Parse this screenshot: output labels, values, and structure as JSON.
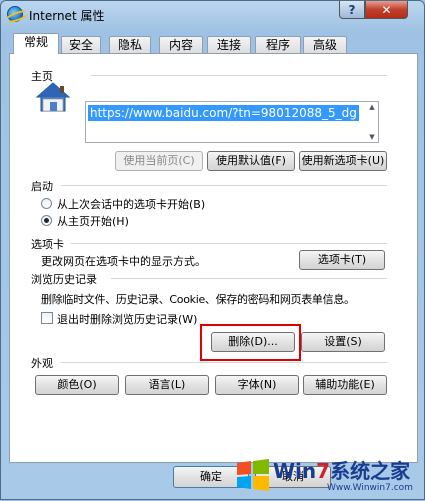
{
  "window": {
    "title": "Internet 属性",
    "help_label": "?",
    "close_label": "✕"
  },
  "tabs": [
    {
      "label": "常规",
      "active": true
    },
    {
      "label": "安全"
    },
    {
      "label": "隐私"
    },
    {
      "label": "内容"
    },
    {
      "label": "连接"
    },
    {
      "label": "程序"
    },
    {
      "label": "高级"
    }
  ],
  "homepage": {
    "title": "主页",
    "url": "https://www.baidu.com/?tn=98012088_5_dg",
    "btn_current": "使用当前页(C)",
    "btn_default": "使用默认值(F)",
    "btn_newtab": "使用新选项卡(U)"
  },
  "startup": {
    "title": "启动",
    "option1": "从上次会话中的选项卡开始(B)",
    "option2": "从主页开始(H)",
    "selected": 2
  },
  "tabs_section": {
    "title": "选项卡",
    "desc": "更改网页在选项卡中的显示方式。",
    "button": "选项卡(T)"
  },
  "history": {
    "title": "浏览历史记录",
    "desc": "删除临时文件、历史记录、Cookie、保存的密码和网页表单信息。",
    "checkbox_label": "退出时删除浏览历史记录(W)",
    "checkbox_checked": false,
    "btn_delete": "删除(D)...",
    "btn_settings": "设置(S)"
  },
  "appearance": {
    "title": "外观",
    "btn_colors": "颜色(O)",
    "btn_languages": "语言(L)",
    "btn_fonts": "字体(N)",
    "btn_accessibility": "辅助功能(E)"
  },
  "footer": {
    "ok": "确定",
    "cancel": "取消"
  },
  "watermark": {
    "brand_prefix": "Win",
    "brand_seven": "7",
    "brand_suffix": "系统之家",
    "url": "Www.Winwin7.com"
  },
  "colors": {
    "highlight": "#e00000",
    "selection": "#3399ff"
  }
}
